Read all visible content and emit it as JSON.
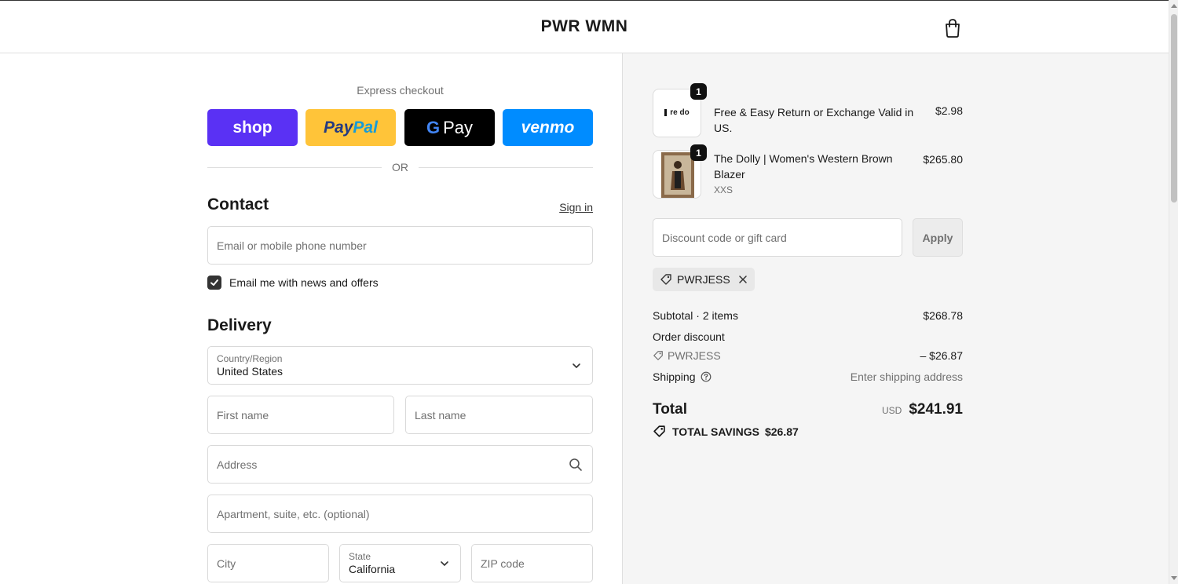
{
  "header": {
    "brand": "PWR WMN",
    "cart_icon": "shopping-bag-icon"
  },
  "express": {
    "title": "Express checkout",
    "buttons": {
      "shop": "shop",
      "paypal_a": "Pay",
      "paypal_b": "Pal",
      "gpay_g": "G",
      "gpay_pay": "Pay",
      "venmo": "venmo"
    },
    "or": "OR"
  },
  "contact": {
    "heading": "Contact",
    "sign_in": "Sign in",
    "email_placeholder": "Email or mobile phone number",
    "news_checkbox": "Email me with news and offers",
    "news_checked": true
  },
  "delivery": {
    "heading": "Delivery",
    "country_label": "Country/Region",
    "country_value": "United States",
    "first_name": "First name",
    "last_name": "Last name",
    "address": "Address",
    "apartment": "Apartment, suite, etc. (optional)",
    "city": "City",
    "state_label": "State",
    "state_value": "California",
    "zip": "ZIP code"
  },
  "order": {
    "items": [
      {
        "thumb_text": "re do",
        "qty": "1",
        "name": "Free & Easy Return or Exchange Valid in US.",
        "variant": "",
        "price": "$2.98"
      },
      {
        "thumb_text": "",
        "qty": "1",
        "name": "The Dolly | Women's Western Brown Blazer",
        "variant": "XXS",
        "price": "$265.80"
      }
    ],
    "discount_placeholder": "Discount code or gift card",
    "apply": "Apply",
    "applied_code": "PWRJESS",
    "subtotal_label": "Subtotal · 2 items",
    "subtotal": "$268.78",
    "order_discount_label": "Order discount",
    "discount_code": "PWRJESS",
    "discount_amount": "– $26.87",
    "shipping_label": "Shipping",
    "shipping_value": "Enter shipping address",
    "total_label": "Total",
    "currency": "USD",
    "total": "$241.91",
    "savings_label": "TOTAL SAVINGS",
    "savings_amount": "$26.87"
  },
  "colors": {
    "shop": "#5a31f4",
    "paypal": "#ffc439",
    "gpay": "#000000",
    "venmo": "#008cff",
    "summary_bg": "#f5f5f5"
  }
}
